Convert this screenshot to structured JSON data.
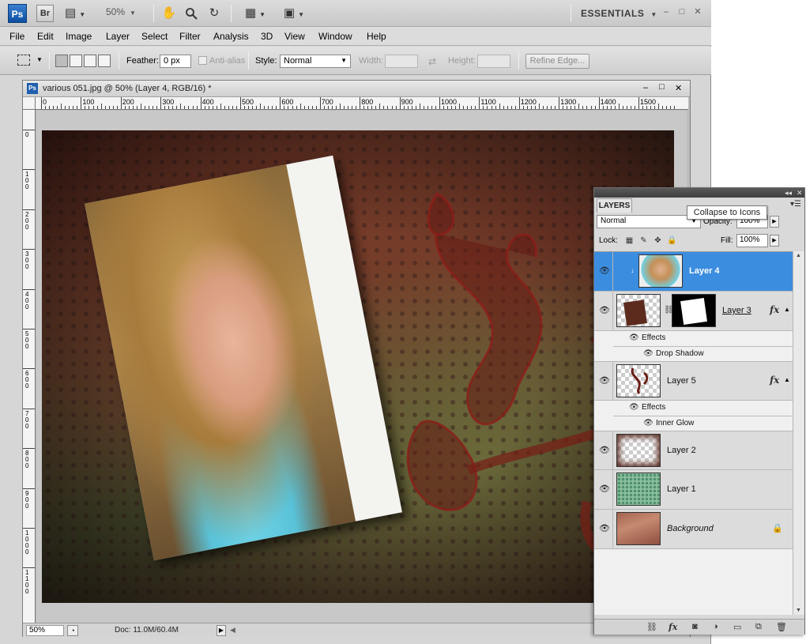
{
  "appbar": {
    "ps_logo": "Ps",
    "br_logo": "Br",
    "zoom": "50%",
    "workspace": "ESSENTIALS",
    "icons": [
      "bridge-icon",
      "video-icon",
      "hand-icon",
      "zoom-icon",
      "rotate-view-icon",
      "arrange-icon",
      "screen-mode-icon"
    ]
  },
  "menu": [
    "File",
    "Edit",
    "Image",
    "Layer",
    "Select",
    "Filter",
    "Analysis",
    "3D",
    "View",
    "Window",
    "Help"
  ],
  "options": {
    "feather_label": "Feather:",
    "feather_value": "0 px",
    "antialias_label": "Anti-alias",
    "style_label": "Style:",
    "style_value": "Normal",
    "width_label": "Width:",
    "height_label": "Height:",
    "refine_edge": "Refine Edge..."
  },
  "document": {
    "title": "various 051.jpg @ 50% (Layer 4, RGB/16) *",
    "ps_badge": "Ps",
    "ruler_labels": [
      "0",
      "100",
      "200",
      "300",
      "400",
      "500",
      "600",
      "700",
      "800",
      "900",
      "1000",
      "1100",
      "1200",
      "1300",
      "1400",
      "1500"
    ],
    "vruler_labels": [
      "0",
      "1 0 0",
      "2 0 0",
      "3 0 0",
      "4 0 0",
      "5 0 0",
      "6 0 0",
      "7 0 0",
      "8 0 0",
      "9 0 0",
      "1 0 0 0",
      "1 1 0 0"
    ],
    "zoom": "50%",
    "doc_info": "Doc: 11.0M/60.4M"
  },
  "layers_panel": {
    "tab": "LAYERS",
    "tooltip": "Collapse to Icons",
    "blend_mode": "Normal",
    "opacity_label": "Opacity:",
    "opacity_value": "100%",
    "lock_label": "Lock:",
    "fill_label": "Fill:",
    "fill_value": "100%",
    "effects_label": "Effects",
    "fx": "fx",
    "layers": [
      {
        "name": "Layer 4",
        "selected": true
      },
      {
        "name": "Layer 3",
        "effect": "Drop Shadow"
      },
      {
        "name": "Layer 5",
        "effect": "Inner Glow"
      },
      {
        "name": "Layer 2"
      },
      {
        "name": "Layer 1"
      },
      {
        "name": "Background",
        "locked": true
      }
    ],
    "bottom_icons": [
      "link-layers-icon",
      "add-style-icon",
      "add-mask-icon",
      "adjustment-layer-icon",
      "new-group-icon",
      "new-layer-icon",
      "delete-layer-icon"
    ]
  },
  "colors": {
    "selection": "#3b8de0",
    "ps_blue": "#1f5fae"
  }
}
